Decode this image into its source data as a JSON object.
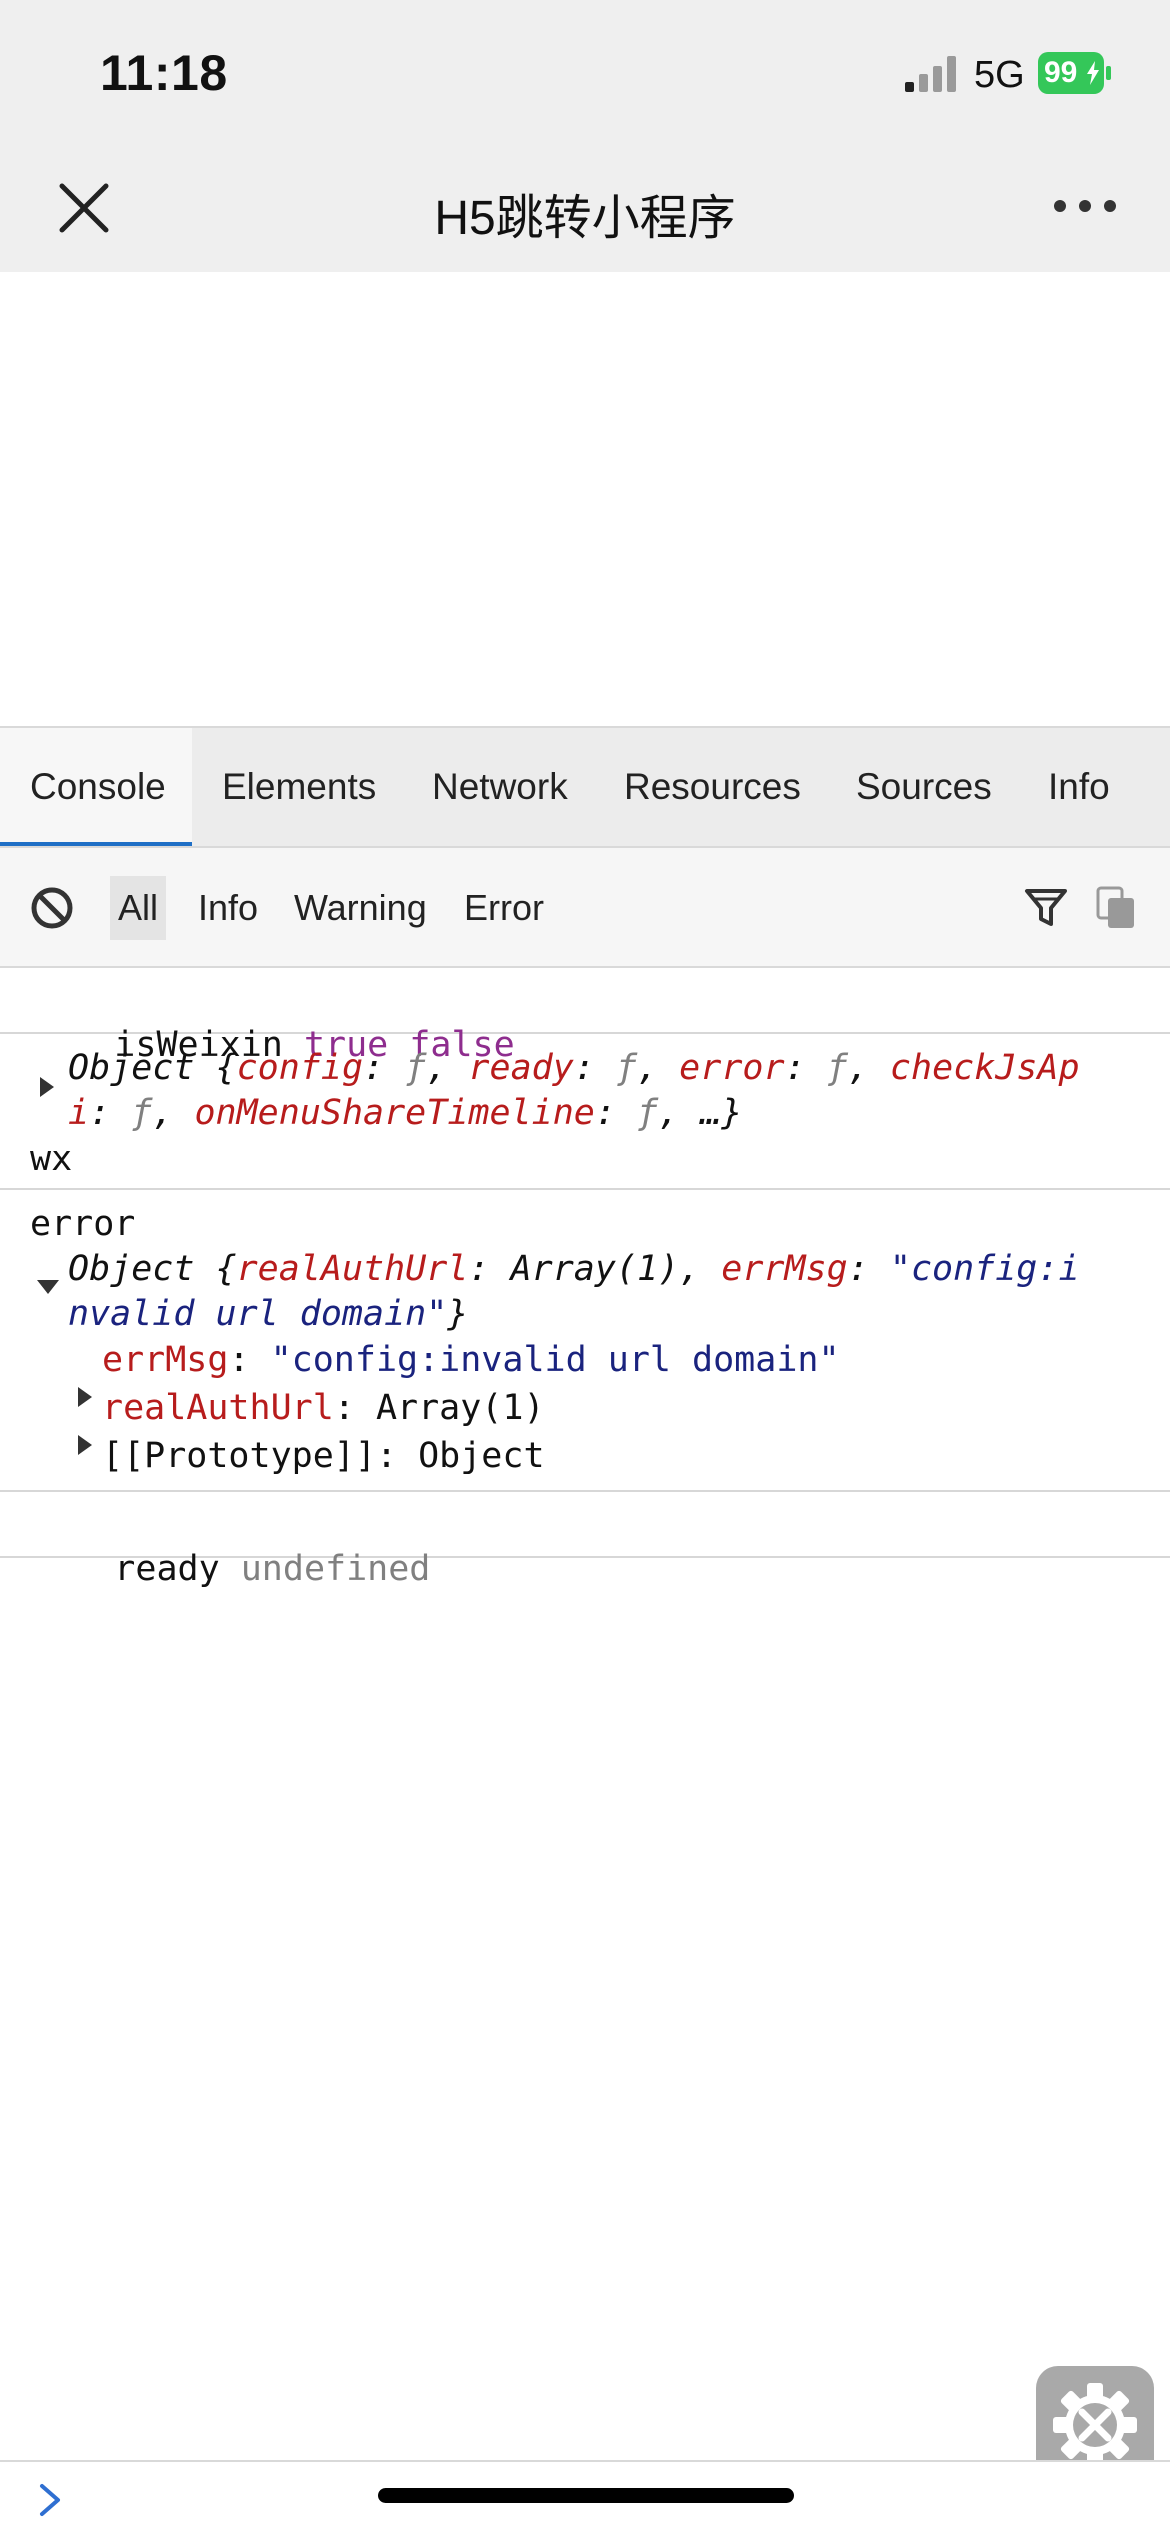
{
  "status_bar": {
    "time": "11:18",
    "network": "5G",
    "battery": "99"
  },
  "nav": {
    "title": "H5跳转小程序",
    "close_icon": "close-icon",
    "more_icon": "more-icon"
  },
  "tabs": [
    {
      "label": "Console",
      "active": true
    },
    {
      "label": "Elements",
      "active": false
    },
    {
      "label": "Network",
      "active": false
    },
    {
      "label": "Resources",
      "active": false
    },
    {
      "label": "Sources",
      "active": false
    },
    {
      "label": "Info",
      "active": false
    }
  ],
  "filters": [
    {
      "label": "All",
      "active": true
    },
    {
      "label": "Info",
      "active": false
    },
    {
      "label": "Warning",
      "active": false
    },
    {
      "label": "Error",
      "active": false
    }
  ],
  "logs": {
    "l1": {
      "a": "isWeixin",
      "b": "true",
      "c": "false"
    },
    "l2": {
      "obj": "Object",
      "brace_open": "{",
      "k1": "config",
      "v1": "ƒ",
      "k2": "ready",
      "v2": "ƒ",
      "k3": "error",
      "v3": "ƒ",
      "k4a": "checkJsAp",
      "k4b": "i",
      "v4": "ƒ",
      "k5": "onMenuShareTimeline",
      "v5": "ƒ",
      "tail": "…}",
      "label": "wx"
    },
    "l3": {
      "label": "error",
      "obj": "Object",
      "k1": "realAuthUrl",
      "v1": "Array(1)",
      "k2": "errMsg",
      "v2a": "\"config:i",
      "v2b": "nvalid url domain\"",
      "close": "}",
      "c1k": "errMsg",
      "c1v": "\"config:invalid url domain\"",
      "c2k": "realAuthUrl",
      "c2v": "Array(1)",
      "c3k": "[[Prototype]]",
      "c3v": "Object"
    },
    "l4": {
      "a": "ready",
      "b": "undefined"
    }
  }
}
